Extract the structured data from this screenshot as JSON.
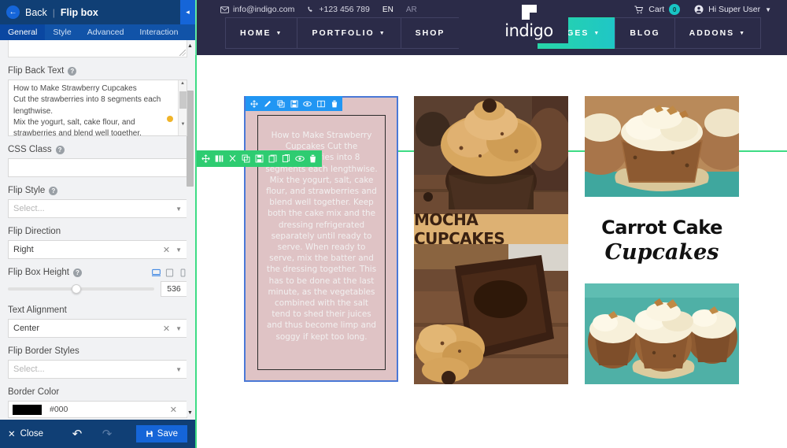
{
  "panel": {
    "back_label": "Back",
    "separator": "|",
    "title": "Flip box",
    "collapse_icon": "chevron-left-icon",
    "tabs": [
      {
        "label": "General",
        "active": true
      },
      {
        "label": "Style",
        "active": false
      },
      {
        "label": "Advanced",
        "active": false
      },
      {
        "label": "Interaction",
        "active": false
      }
    ],
    "fields": {
      "flip_back_text": {
        "label": "Flip Back Text",
        "value": "How to Make Strawberry Cupcakes\nCut the strawberries into 8 segments each lengthwise.\nMix the yogurt, salt, cake flour, and strawberries and blend well together.\nKeep both the cake mix and the dressing refrigerated separately until ready to serve."
      },
      "css_class": {
        "label": "CSS Class",
        "value": ""
      },
      "flip_style": {
        "label": "Flip Style",
        "placeholder": "Select...",
        "value": ""
      },
      "flip_direction": {
        "label": "Flip Direction",
        "value": "Right"
      },
      "flip_box_height": {
        "label": "Flip Box Height",
        "value": "536",
        "slider_percent": 47
      },
      "text_alignment": {
        "label": "Text Alignment",
        "value": "Center"
      },
      "flip_border_styles": {
        "label": "Flip Border Styles",
        "placeholder": "Select...",
        "value": ""
      },
      "border_color": {
        "label": "Border Color",
        "value": "#000",
        "swatch": "#000000"
      }
    },
    "device_icons": [
      "desktop-icon",
      "tablet-icon",
      "mobile-icon"
    ],
    "footer": {
      "close_label": "Close",
      "undo_icon": "undo-icon",
      "redo_icon": "redo-icon",
      "save_label": "Save"
    }
  },
  "site": {
    "topbar": {
      "email": "info@indigo.com",
      "phone": "+123 456 789",
      "lang_active": "EN",
      "lang_inactive": "AR",
      "cart_label": "Cart",
      "cart_count": "0",
      "user_label": "Hi Super User"
    },
    "brand": "indigo",
    "menu": [
      {
        "label": "HOME",
        "caret": true,
        "active": false
      },
      {
        "label": "PORTFOLIO",
        "caret": true,
        "active": false
      },
      {
        "label": "SHOP",
        "caret": false,
        "active": false
      },
      {
        "label": "PAGES",
        "caret": true,
        "active": true
      },
      {
        "label": "BLOG",
        "caret": false,
        "active": false
      },
      {
        "label": "ADDONS",
        "caret": true,
        "active": false
      }
    ]
  },
  "editor": {
    "row_toolbar_icons": [
      "move-icon",
      "columns-icon",
      "cut-icon",
      "copy-icon",
      "save-icon",
      "duplicate-icon",
      "paste-icon",
      "eye-icon",
      "trash-icon"
    ],
    "module_toolbar_icons": [
      "move-icon",
      "edit-icon",
      "copy-icon",
      "save-icon",
      "eye-icon",
      "columns-icon",
      "trash-icon"
    ],
    "flip_box_text": "How to Make Strawberry Cupcakes Cut the strawberries into 8 segments each lengthwise. Mix the yogurt, salt, cake flour, and strawberries and blend well together. Keep both the cake mix and the dressing refrigerated separately until ready to serve. When ready to serve, mix the batter and the dressing together. This has to be done at the last minute, as the vegetables combined with the salt tend to shed their juices and thus become limp and soggy if kept too long.",
    "cards": [
      {
        "title": "MOCHA CUPCAKES"
      },
      {
        "title_line1": "Carrot Cake",
        "title_line2": "Cupcakes"
      }
    ]
  },
  "colors": {
    "panel_header": "#103f75",
    "tab_bar": "#1153a8",
    "accent_blue": "#1565d8",
    "row_green": "#2ecc71",
    "module_blue": "#2196f3",
    "site_nav": "#2b2b48",
    "nav_active": "#27d6a8",
    "flip_bg": "#dfc3c5"
  }
}
